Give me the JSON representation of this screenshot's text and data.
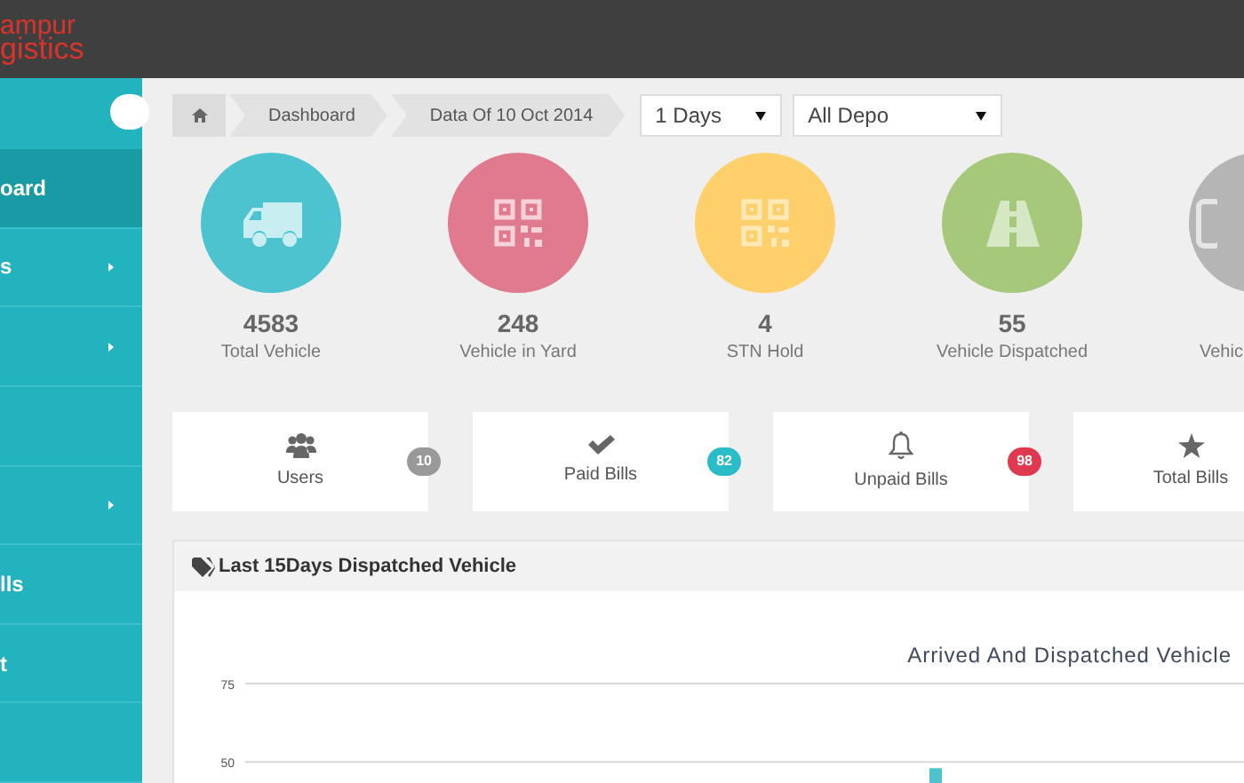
{
  "logo": {
    "line_1": "ampur",
    "line_2": "gistics"
  },
  "sidebar": {
    "items": [
      {
        "label": "oard",
        "selected": true,
        "has_submenu": false
      },
      {
        "label": "s",
        "selected": false,
        "has_submenu": true
      },
      {
        "selected": false,
        "has_submenu": true
      },
      {
        "selected": false,
        "has_submenu": false
      },
      {
        "selected": false,
        "has_submenu": true
      },
      {
        "label": "lls",
        "selected": false,
        "has_submenu": false
      },
      {
        "label": "t",
        "selected": false,
        "has_submenu": false
      },
      {
        "selected": false,
        "has_submenu": false
      }
    ]
  },
  "breadcrumb": [
    "Dashboard",
    "Data Of 10 Oct 2014"
  ],
  "filters": [
    {
      "value": "1 Days"
    },
    {
      "value": "All Depo"
    }
  ],
  "stats": [
    {
      "kind": "truck",
      "value": "4583",
      "label": "Total Vehicle",
      "color": "#4cc3cf"
    },
    {
      "kind": "qr",
      "value": "248",
      "label": "Vehicle in Yard",
      "color": "#e07a8f"
    },
    {
      "kind": "qr",
      "value": "4",
      "label": "STN Hold",
      "color": "#fdd06b"
    },
    {
      "kind": "road",
      "value": "55",
      "label": "Vehicle Dispatched",
      "color": "#a6c87a"
    },
    {
      "kind": "other",
      "label": "Vehic",
      "color": "#b5b5b5"
    }
  ],
  "cards": [
    {
      "kind": "users",
      "label": "Users",
      "badge": "10",
      "color": "#999999"
    },
    {
      "kind": "check",
      "label": "Paid Bills",
      "badge": "82",
      "color": "#2bbcc9"
    },
    {
      "kind": "bell",
      "label": "Unpaid Bills",
      "badge": "98",
      "color": "#e0394f"
    },
    {
      "kind": "star",
      "label": "Total Bills"
    }
  ],
  "panel": {
    "title": "Last 15Days Dispatched Vehicle",
    "chart_data": {
      "type": "bar",
      "title": "Arrived And Dispatched Vehicle",
      "ylim": [
        41,
        75
      ],
      "yticks": [
        50,
        75
      ],
      "values": [
        48
      ]
    }
  }
}
